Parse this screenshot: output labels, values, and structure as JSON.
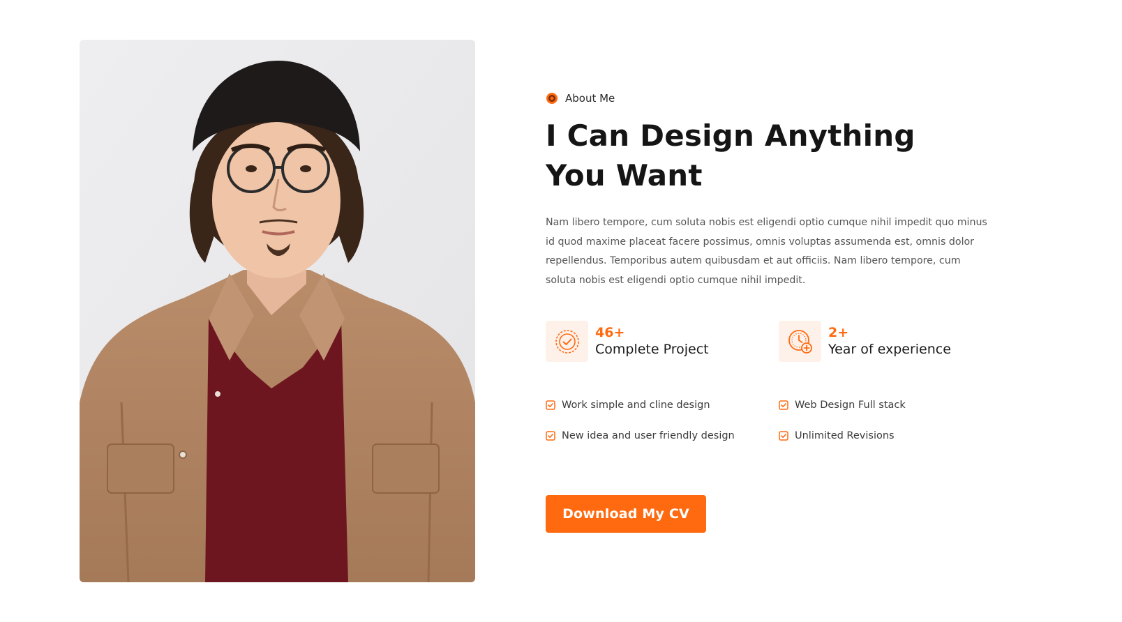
{
  "colors": {
    "accent": "#ff6a10",
    "accent_soft": "#fdf1ea",
    "heading": "#151515",
    "body_text": "#555555"
  },
  "photo": {
    "icon": "portrait-photo"
  },
  "about": {
    "eyebrow_icon": "orange-dot-icon",
    "eyebrow": "About Me",
    "heading": "I Can Design Anything You Want",
    "description": "Nam libero tempore, cum soluta nobis est eligendi optio cumque nihil impedit quo minus id quod maxime placeat facere possimus, omnis voluptas assumenda est, omnis dolor repellendus. Temporibus autem quibusdam et aut officiis. Nam libero tempore, cum soluta nobis est eligendi optio cumque nihil impedit."
  },
  "stats": [
    {
      "icon": "badge-check-icon",
      "value": "46+",
      "label": "Complete Project"
    },
    {
      "icon": "clock-plus-icon",
      "value": "2+",
      "label": "Year of experience"
    }
  ],
  "features": [
    {
      "icon": "checkbox-icon",
      "label": "Work simple and cline design"
    },
    {
      "icon": "checkbox-icon",
      "label": "Web Design Full stack"
    },
    {
      "icon": "checkbox-icon",
      "label": "New idea and user friendly design"
    },
    {
      "icon": "checkbox-icon",
      "label": "Unlimited Revisions"
    }
  ],
  "cta": {
    "label": "Download My CV"
  }
}
